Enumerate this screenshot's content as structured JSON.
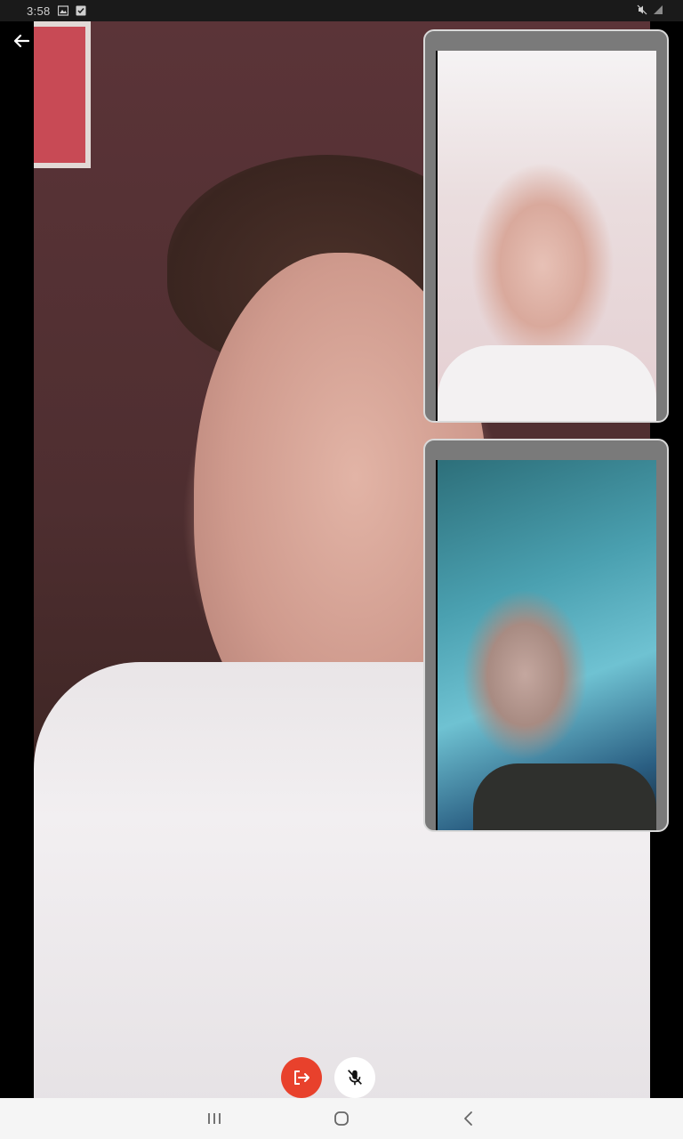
{
  "status_bar": {
    "time": "3:58",
    "icons": [
      "image-icon",
      "checkbox-notification-icon",
      "mute-icon",
      "signal-icon"
    ]
  },
  "navigation": {
    "back_icon": "arrow-back-icon"
  },
  "main_video": {
    "participant": "local-participant"
  },
  "participant_tiles": [
    {
      "id": "participant-1"
    },
    {
      "id": "participant-2"
    }
  ],
  "call_controls": {
    "leave_icon": "leave-call-icon",
    "mute_icon": "mic-off-icon",
    "colors": {
      "leave": "#e8412c",
      "mute": "#ffffff"
    }
  },
  "system_nav": {
    "recents_icon": "recents-icon",
    "home_icon": "home-icon",
    "back_icon": "nav-back-icon"
  }
}
